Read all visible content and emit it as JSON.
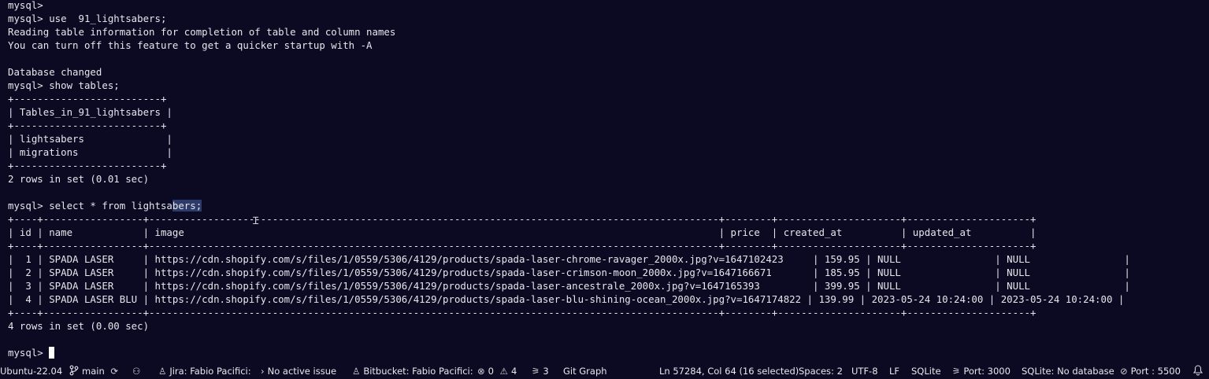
{
  "terminal": {
    "lines": [
      "mysql>",
      "mysql> use  91_lightsabers;",
      "Reading table information for completion of table and column names",
      "You can turn off this feature to get a quicker startup with -A",
      "",
      "Database changed",
      "mysql> show tables;",
      "+-------------------------+",
      "| Tables_in_91_lightsabers |",
      "+-------------------------+",
      "| lightsabers              |",
      "| migrations               |",
      "+-------------------------+",
      "2 rows in set (0.01 sec)",
      "",
      "mysql> select * from lightsabers;",
      "+----+-----------------+-------------------------------------------------------------------------------------------------+--------+---------------------+---------------------+",
      "| id | name            | image                                                                                           | price  | created_at          | updated_at          |",
      "+----+-----------------+-------------------------------------------------------------------------------------------------+--------+---------------------+---------------------+",
      "|  1 | SPADA LASER     | https://cdn.shopify.com/s/files/1/0559/5306/4129/products/spada-laser-chrome-ravager_2000x.jpg?v=1647102423     | 159.95 | NULL                | NULL                |",
      "|  2 | SPADA LASER     | https://cdn.shopify.com/s/files/1/0559/5306/4129/products/spada-laser-crimson-moon_2000x.jpg?v=1647166671       | 185.95 | NULL                | NULL                |",
      "|  3 | SPADA LASER     | https://cdn.shopify.com/s/files/1/0559/5306/4129/products/spada-laser-ancestrale_2000x.jpg?v=1647165393         | 399.95 | NULL                | NULL                |",
      "|  4 | SPADA LASER BLU | https://cdn.shopify.com/s/files/1/0559/5306/4129/products/spada-laser-blu-shining-ocean_2000x.jpg?v=1647174822 | 139.99 | 2023-05-24 10:24:00 | 2023-05-24 10:24:00 |",
      "+----+-----------------+-------------------------------------------------------------------------------------------------+--------+---------------------+---------------------+",
      "4 rows in set (0.00 sec)",
      "",
      "mysql> "
    ],
    "select_line": {
      "before": "mysql> select * from lightsa",
      "selected": "bers;"
    }
  },
  "statusbar": {
    "remote": "Ubuntu-22.04",
    "branch": "main",
    "jira": "Jira: Fabio Pacifici:",
    "issue": "No active issue",
    "bitbucket": "Bitbucket: Fabio Pacifici:",
    "errors": "0",
    "warnings": "4",
    "ports_count": "3",
    "git_graph": "Git Graph",
    "cursor_pos": "Ln 57284, Col 64 (16 selected)",
    "spaces": "Spaces: 2",
    "encoding": "UTF-8",
    "eol": "LF",
    "language": "SQLite",
    "port": "Port: 3000",
    "sqlite": "SQLite: No database",
    "live_port": "Port : 5500"
  },
  "icons": {
    "branch": "git-branch-icon",
    "sync": "sync-icon",
    "live_share": "live-share-icon",
    "jira": "person-icon",
    "issue": "chevron-right-icon",
    "bitbucket": "person-icon",
    "errors": "error-icon",
    "warnings": "warning-icon",
    "ports": "broadcast-icon",
    "port": "broadcast-icon",
    "live_port": "block-icon",
    "notifications": "bell-icon"
  },
  "colors": {
    "background": "#0b0a22",
    "text": "#e6e6ec",
    "selection": "#2c3b6a"
  }
}
